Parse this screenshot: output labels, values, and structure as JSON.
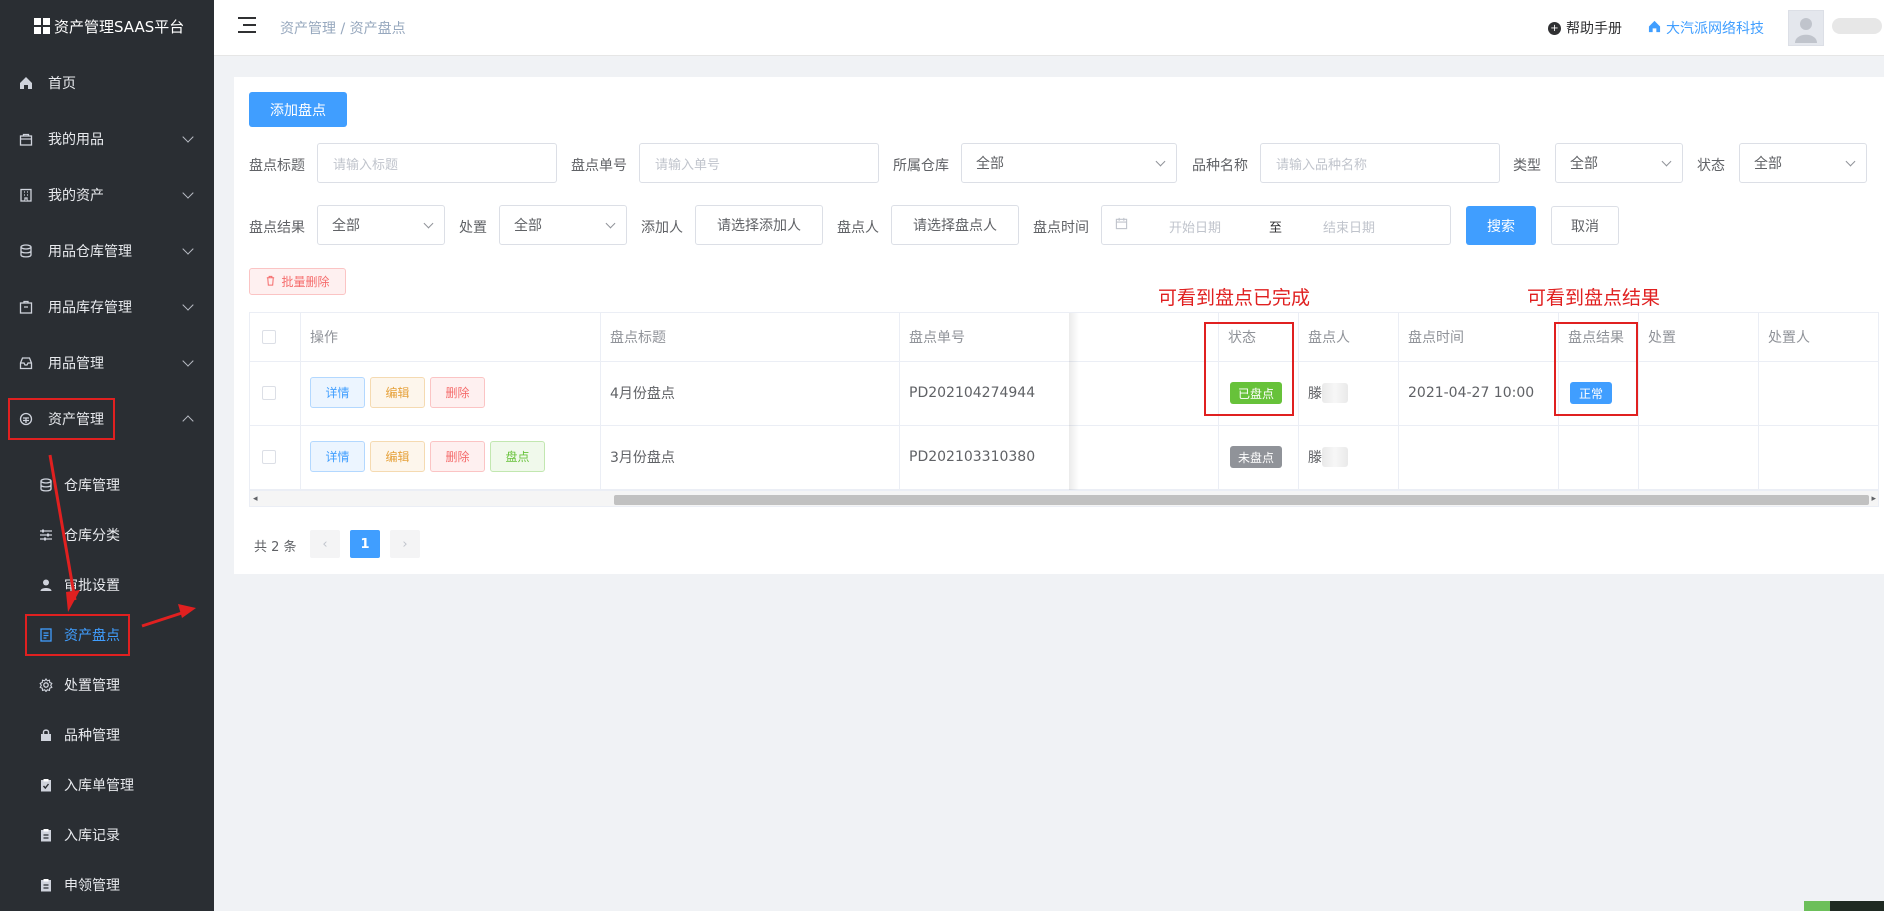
{
  "app": {
    "title": "资产管理SAAS平台"
  },
  "sidebar": {
    "items": [
      {
        "label": "首页",
        "icon": "home-icon"
      },
      {
        "label": "我的用品",
        "icon": "bag-icon"
      },
      {
        "label": "我的资产",
        "icon": "building-icon"
      },
      {
        "label": "用品仓库管理",
        "icon": "database-icon"
      },
      {
        "label": "用品库存管理",
        "icon": "box-icon"
      },
      {
        "label": "用品管理",
        "icon": "tray-icon"
      },
      {
        "label": "资产管理",
        "icon": "asset-icon"
      }
    ],
    "subitems": [
      {
        "label": "仓库管理",
        "icon": "database-icon"
      },
      {
        "label": "仓库分类",
        "icon": "sliders-icon"
      },
      {
        "label": "审批设置",
        "icon": "user-icon"
      },
      {
        "label": "资产盘点",
        "icon": "document-icon"
      },
      {
        "label": "处置管理",
        "icon": "gear-icon"
      },
      {
        "label": "品种管理",
        "icon": "lock-icon"
      },
      {
        "label": "入库单管理",
        "icon": "clipboard-icon"
      },
      {
        "label": "入库记录",
        "icon": "clipboard-icon"
      },
      {
        "label": "申领管理",
        "icon": "clipboard-icon"
      }
    ]
  },
  "header": {
    "breadcrumb": "资产管理 / 资产盘点",
    "help": "帮助手册",
    "company": "大汽派网络科技"
  },
  "toolbar": {
    "add_label": "添加盘点",
    "batch_delete_label": "批量删除"
  },
  "filters": {
    "title_label": "盘点标题",
    "title_placeholder": "请输入标题",
    "number_label": "盘点单号",
    "number_placeholder": "请输入单号",
    "warehouse_label": "所属仓库",
    "warehouse_value": "全部",
    "variety_label": "品种名称",
    "variety_placeholder": "请输入品种名称",
    "type_label": "类型",
    "type_value": "全部",
    "status_label": "状态",
    "status_value": "全部",
    "result_label": "盘点结果",
    "result_value": "全部",
    "dispose_label": "处置",
    "dispose_value": "全部",
    "adder_label": "添加人",
    "adder_button": "请选择添加人",
    "counter_label": "盘点人",
    "counter_button": "请选择盘点人",
    "time_label": "盘点时间",
    "start_placeholder": "开始日期",
    "range_sep": "至",
    "end_placeholder": "结束日期",
    "search_label": "搜索",
    "cancel_label": "取消"
  },
  "annotations": {
    "status_note": "可看到盘点已完成",
    "result_note": "可看到盘点结果"
  },
  "table": {
    "headers": {
      "action": "操作",
      "title": "盘点标题",
      "number": "盘点单号",
      "status": "状态",
      "counter": "盘点人",
      "time": "盘点时间",
      "result": "盘点结果",
      "dispose": "处置",
      "disposer": "处置人"
    },
    "actions": {
      "detail": "详情",
      "edit": "编辑",
      "delete": "删除",
      "count": "盘点"
    },
    "rows": [
      {
        "title": "4月份盘点",
        "number": "PD202104274944",
        "status": "已盘点",
        "counter": "滕",
        "time": "2021-04-27 10:00",
        "result": "正常"
      },
      {
        "title": "3月份盘点",
        "number": "PD202103310380",
        "status": "未盘点",
        "counter": "滕",
        "time": "",
        "result": ""
      }
    ]
  },
  "pagination": {
    "total": "共 2 条",
    "current": "1"
  },
  "colors": {
    "primary": "#409eff",
    "sidebar": "#2a2e33",
    "success": "#67c23a",
    "info": "#909399",
    "annotation": "#e02020"
  }
}
